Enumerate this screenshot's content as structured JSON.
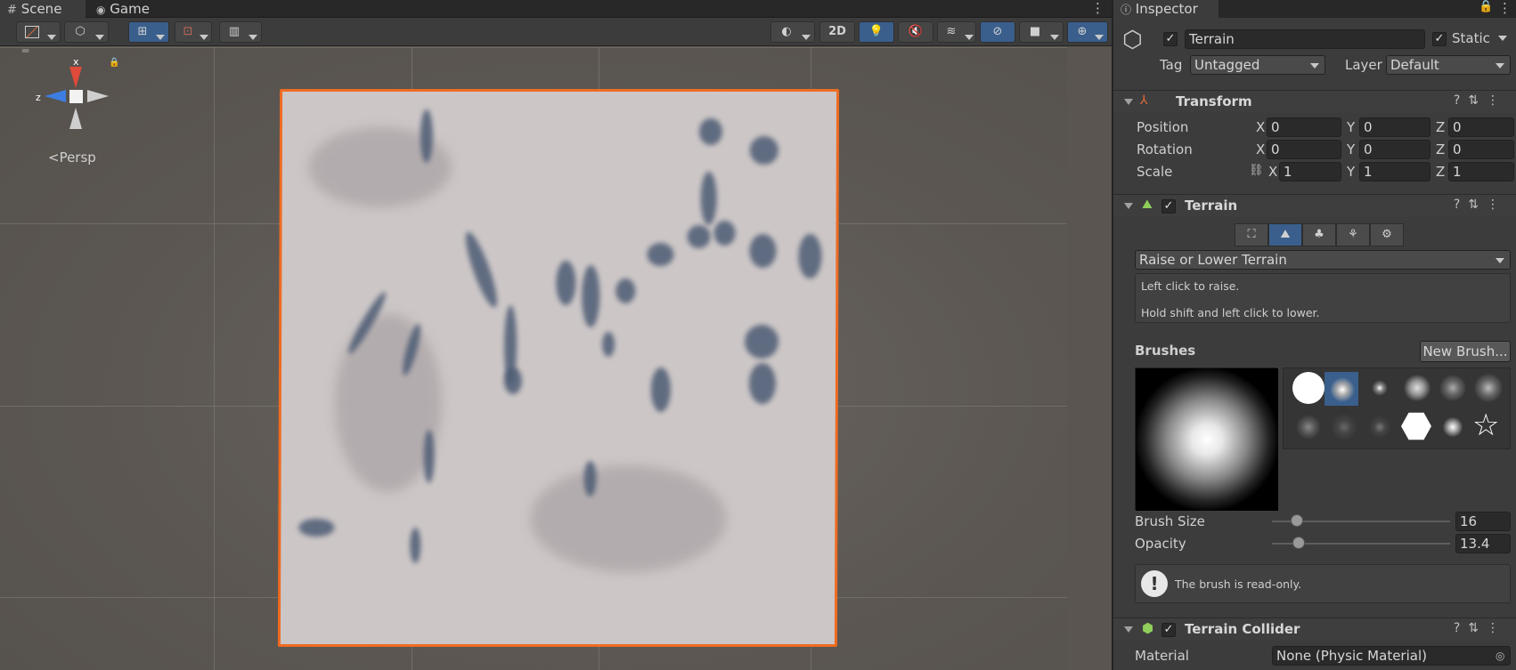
{
  "tabs": {
    "scene": "Scene",
    "game": "Game"
  },
  "scene": {
    "view_2d": "2D",
    "persp_label": "<Persp",
    "gizmo": {
      "x": "x",
      "z": "z"
    }
  },
  "inspector": {
    "tab": "Inspector",
    "object_name": "Terrain",
    "static_label": "Static",
    "tag_label": "Tag",
    "tag_value": "Untagged",
    "layer_label": "Layer",
    "layer_value": "Default",
    "transform": {
      "title": "Transform",
      "position_label": "Position",
      "rotation_label": "Rotation",
      "scale_label": "Scale",
      "axis_x": "X",
      "axis_y": "Y",
      "axis_z": "Z",
      "position": {
        "x": "0",
        "y": "0",
        "z": "0"
      },
      "rotation": {
        "x": "0",
        "y": "0",
        "z": "0"
      },
      "scale": {
        "x": "1",
        "y": "1",
        "z": "1"
      }
    },
    "terrain": {
      "title": "Terrain",
      "tool_dropdown": "Raise or Lower Terrain",
      "help_line1": "Left click to raise.",
      "help_line2": "Hold shift and left click to lower.",
      "brushes_label": "Brushes",
      "new_brush": "New Brush...",
      "brush_size_label": "Brush Size",
      "brush_size_value": "16",
      "brush_size_fraction": 0.14,
      "opacity_label": "Opacity",
      "opacity_value": "13.4",
      "opacity_fraction": 0.15,
      "readonly_note": "The brush is read-only."
    },
    "collider": {
      "title": "Terrain Collider",
      "material_label": "Material",
      "material_value": "None (Physic Material)"
    }
  },
  "colors": {
    "accent": "#3a5f8c",
    "selection": "#ef6b22",
    "gizmo_x": "#e04a3a",
    "gizmo_z": "#3d7de0"
  }
}
